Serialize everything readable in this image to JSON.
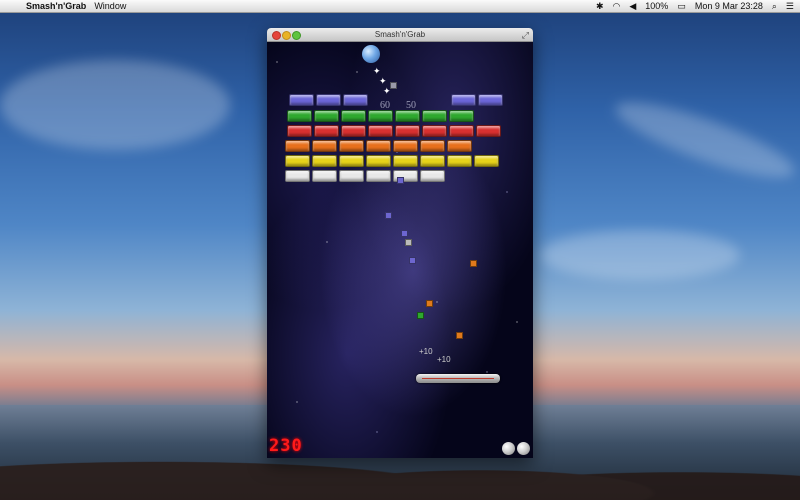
{
  "menubar": {
    "apple_icon": "apple-logo-icon",
    "app_name": "Smash'n'Grab",
    "items": [
      "Window"
    ],
    "battery": "100%",
    "clock": "Mon 9 Mar  23:28",
    "status_icons": [
      "bluetooth-icon",
      "wifi-icon",
      "volume-icon",
      "battery-icon",
      "spotlight-icon",
      "notification-list-icon"
    ]
  },
  "window": {
    "title": "Smash'n'Grab"
  },
  "game": {
    "score": "230",
    "lives_remaining": 2,
    "floating_scores": [
      "60",
      "50"
    ],
    "paddle_labels": [
      "+10",
      "+10"
    ],
    "brick_colors": {
      "blue": "#6c66d8",
      "green": "#2ea82e",
      "red": "#d93030",
      "orange": "#e8701c",
      "yellow": "#e6d21a",
      "white": "#e8e8e8"
    }
  }
}
